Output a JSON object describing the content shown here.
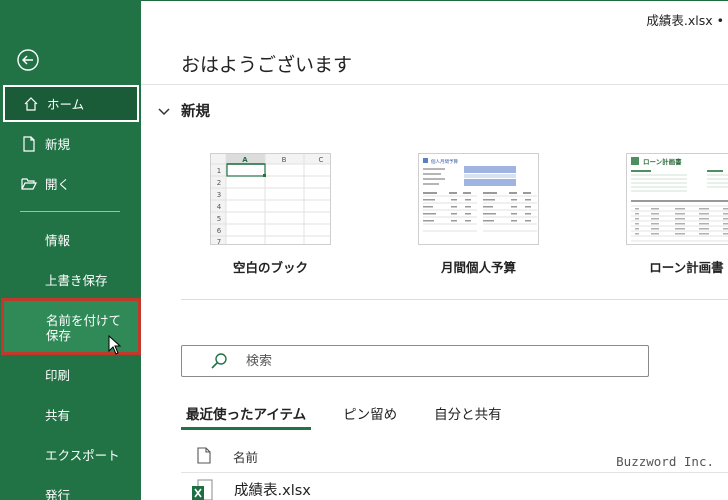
{
  "window": {
    "file_title": "成績表.xlsx •"
  },
  "sidebar": {
    "items": [
      {
        "label": "ホーム"
      },
      {
        "label": "新規"
      },
      {
        "label": "開く"
      },
      {
        "label": "情報"
      },
      {
        "label": "上書き保存"
      },
      {
        "label": "名前を付けて保存"
      },
      {
        "label": "印刷"
      },
      {
        "label": "共有"
      },
      {
        "label": "エクスポート"
      },
      {
        "label": "発行"
      }
    ]
  },
  "main": {
    "greeting": "おはようございます",
    "new_section": {
      "heading": "新規",
      "templates": [
        {
          "label": "空白のブック"
        },
        {
          "label": "月間個人予算"
        },
        {
          "label": "ローン計画書"
        }
      ],
      "blank_grid": {
        "columns": [
          "A",
          "B",
          "C"
        ],
        "rows": [
          "1",
          "2",
          "3",
          "4",
          "5",
          "6",
          "7"
        ]
      },
      "budget_title": "個人月間予算",
      "loan_title": "ローン計画書"
    },
    "search": {
      "placeholder": "検索"
    },
    "tabs": [
      {
        "label": "最近使ったアイテム"
      },
      {
        "label": "ピン留め"
      },
      {
        "label": "自分と共有"
      }
    ],
    "file_list": {
      "column_name": "名前",
      "files": [
        {
          "name": "成績表.xlsx"
        }
      ]
    },
    "watermark": "Buzzword Inc."
  },
  "colors": {
    "sidebar": "#217346",
    "highlight_border": "#c0392b",
    "accent": "#217346"
  }
}
